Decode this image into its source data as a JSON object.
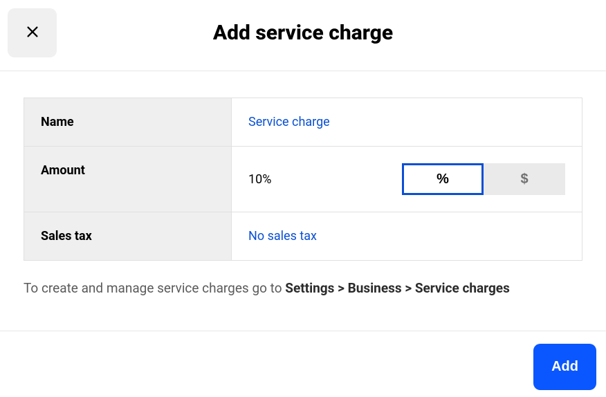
{
  "header": {
    "title": "Add service charge"
  },
  "fields": {
    "name": {
      "label": "Name",
      "value": "Service charge"
    },
    "amount": {
      "label": "Amount",
      "value": "10%",
      "toggle": {
        "percent": "%",
        "currency": "$"
      }
    },
    "sales_tax": {
      "label": "Sales tax",
      "value": "No sales tax"
    }
  },
  "help": {
    "prefix": "To create and manage service charges go to ",
    "path": "Settings > Business > Service charges"
  },
  "footer": {
    "add_label": "Add"
  }
}
